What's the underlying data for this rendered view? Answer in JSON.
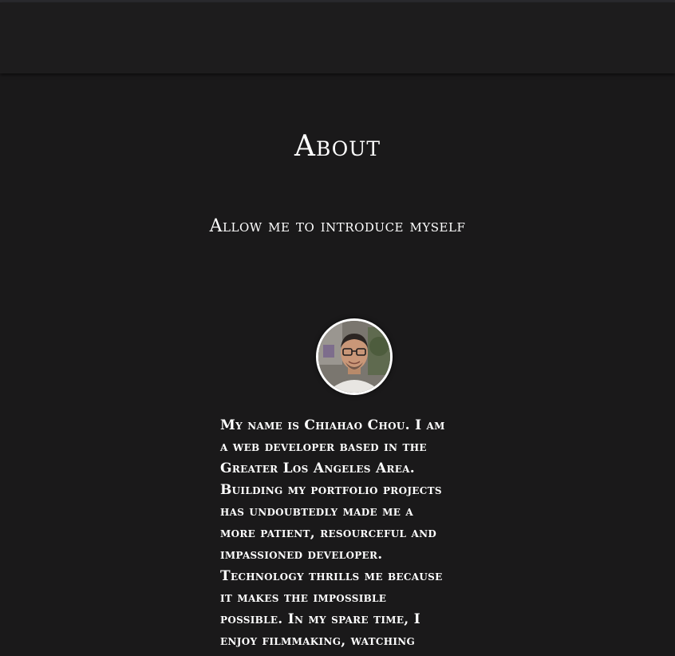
{
  "header": {
    "title": "About",
    "subtitle": "Allow me to introduce myself"
  },
  "profile": {
    "avatar_icon": "profile-photo",
    "bio_lines": [
      "My name is Chiahao Chou. I am",
      "a web developer based in the",
      "Greater Los Angeles Area.",
      "Building my portfolio projects",
      "has undoubtedly made me a",
      "more patient, resourceful and",
      "impassioned developer.",
      "Technology thrills me because",
      "it makes the impossible",
      "possible. In my spare time, I",
      "enjoy filmmaking, watching"
    ]
  },
  "colors": {
    "background": "#1a191a",
    "navbar": "#1d1c1d",
    "text": "#ffffff"
  }
}
